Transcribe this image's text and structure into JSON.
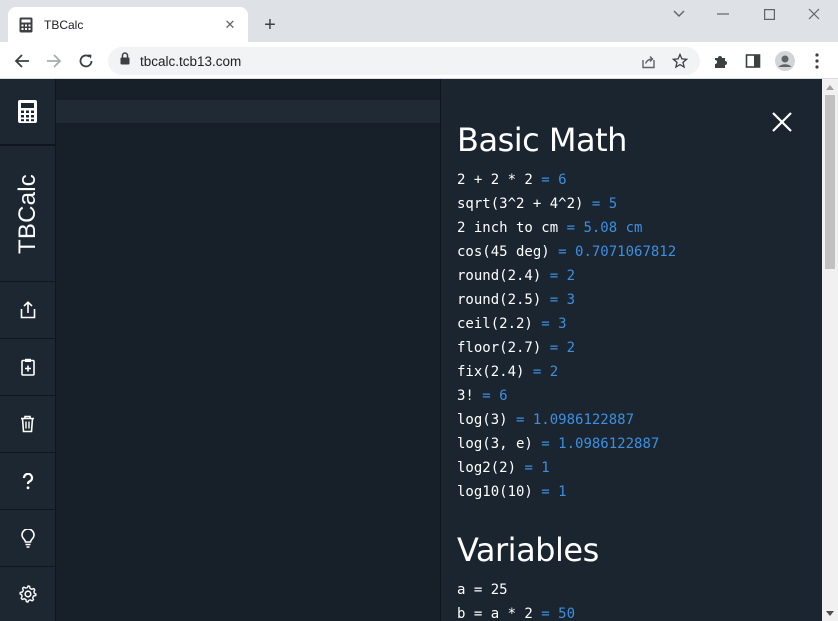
{
  "browser": {
    "tab_title": "TBCalc",
    "tab_close": "✕",
    "new_tab": "+",
    "url": "tbcalc.tcb13.com"
  },
  "app": {
    "brand": "TBCalc",
    "sidebar_icons": [
      "calculator-icon",
      "share-icon",
      "clipboard-icon",
      "trash-icon",
      "help-icon",
      "lightbulb-icon",
      "settings-icon"
    ]
  },
  "help": {
    "basic_title": "Basic Math",
    "basic_lines": [
      {
        "expr": "2 + 2 * 2",
        "result": "= 6"
      },
      {
        "expr": "sqrt(3^2 + 4^2)",
        "result": "= 5"
      },
      {
        "expr": "2 inch to cm",
        "result": "= 5.08 cm"
      },
      {
        "expr": "cos(45 deg)",
        "result": "= 0.7071067812"
      },
      {
        "expr": "round(2.4)",
        "result": "= 2"
      },
      {
        "expr": "round(2.5)",
        "result": "= 3"
      },
      {
        "expr": "ceil(2.2)",
        "result": "= 3"
      },
      {
        "expr": "floor(2.7)",
        "result": "= 2"
      },
      {
        "expr": "fix(2.4)",
        "result": "= 2"
      },
      {
        "expr": "3!",
        "result": "= 6"
      },
      {
        "expr": "log(3)",
        "result": "= 1.0986122887"
      },
      {
        "expr": "log(3, e)",
        "result": "= 1.0986122887"
      },
      {
        "expr": "log2(2)",
        "result": "= 1"
      },
      {
        "expr": "log10(10)",
        "result": "= 1"
      }
    ],
    "variables_title": "Variables",
    "variables_lines": [
      {
        "expr": "a = 25",
        "result": ""
      },
      {
        "expr": "b = a * 2",
        "result": "= 50"
      }
    ]
  },
  "colors": {
    "result": "#3d8fe0",
    "panel_bg": "#1b2530",
    "editor_bg": "#171f28"
  }
}
